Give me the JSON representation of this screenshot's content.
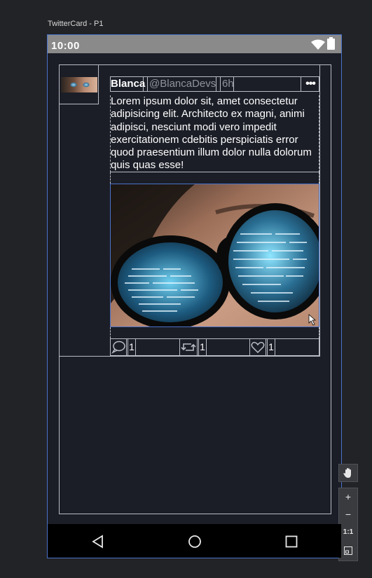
{
  "frame": {
    "title": "TwitterCard - P1"
  },
  "status_bar": {
    "time": "10:00",
    "icons": [
      "wifi-icon",
      "battery-icon"
    ]
  },
  "tweet": {
    "display_name": "Blanca",
    "handle": "@BlancaDevs",
    "timestamp": "6h",
    "more_label": "•••",
    "text": "Lorem ipsum dolor sit, amet consectetur adipisicing elit. Architecto ex magni, animi adipisci, nesciunt modi vero impedit exercitationem cdebitis perspiciatis error quod praesentium illum dolor nulla dolorum quis quas esse!",
    "actions": {
      "reply_count": "1",
      "retweet_count": "1",
      "like_count": "1"
    }
  },
  "zoom_toolbar": {
    "zoom_in": "+",
    "zoom_out": "−",
    "actual_size": "1:1"
  },
  "colors": {
    "background": "#1b1e27",
    "selection": "#4a72c9",
    "outline": "#b9bcc4"
  }
}
